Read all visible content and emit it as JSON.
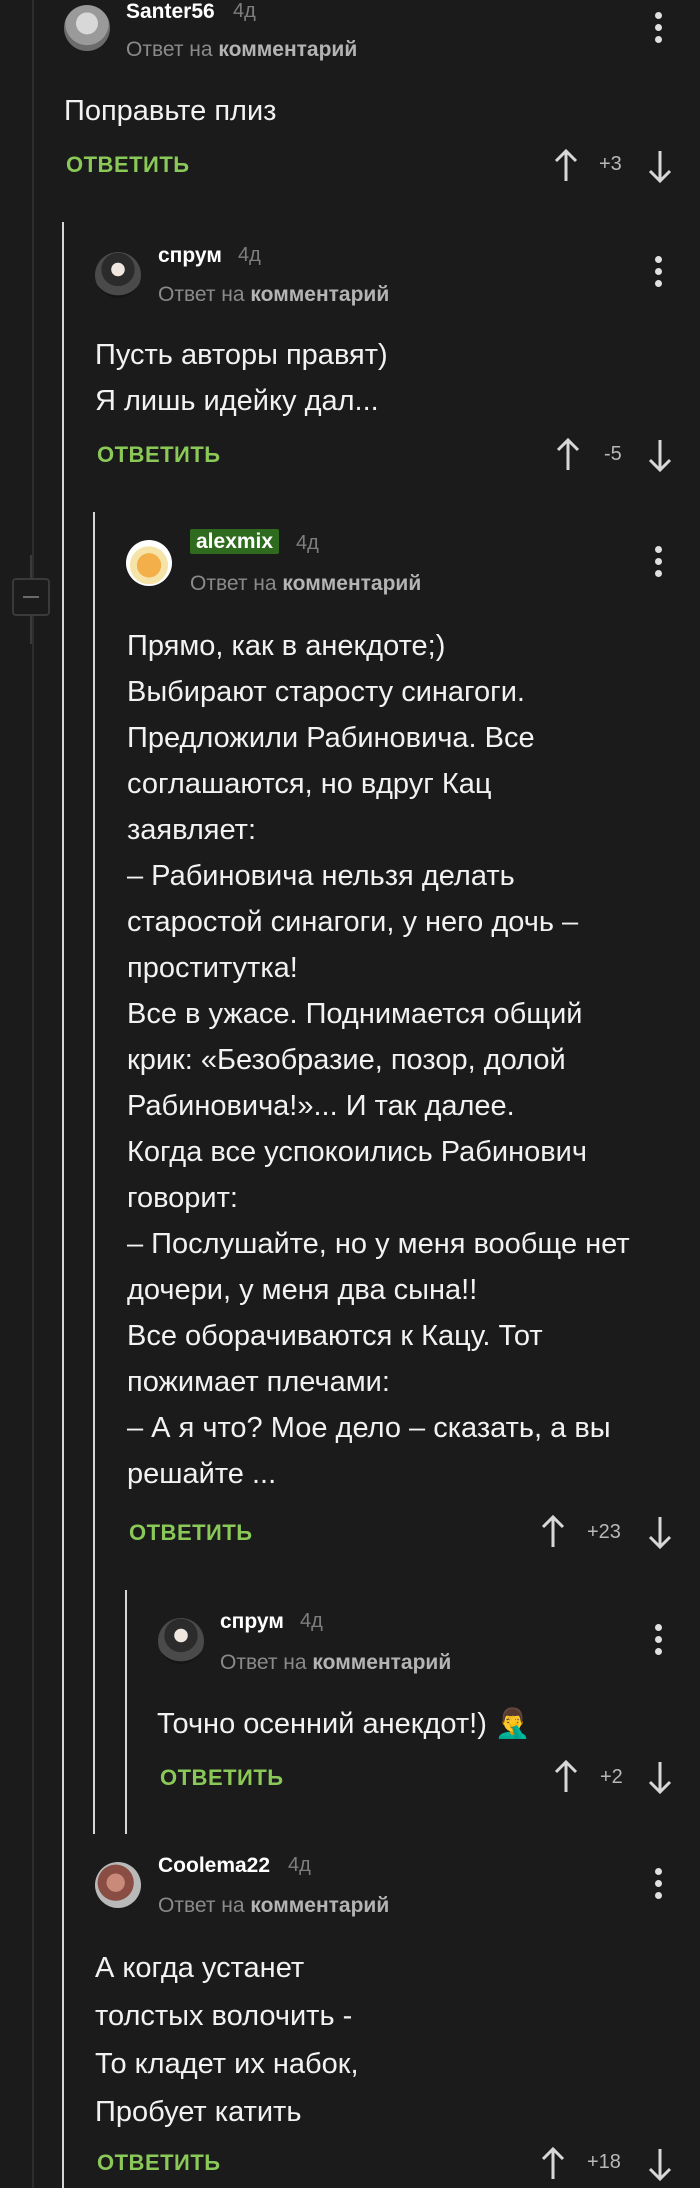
{
  "comments": [
    {
      "id": "c1",
      "author": "Santer56",
      "time": "4д",
      "reply_prefix": "Ответ на ",
      "reply_link": "комментарий",
      "text": "Поправьте плиз",
      "reply_label": "ОТВЕТИТЬ",
      "rating": "+3"
    },
    {
      "id": "c2",
      "author": "спрум",
      "time": "4д",
      "reply_prefix": "Ответ на ",
      "reply_link": "комментарий",
      "text": "Пусть авторы правят)\nЯ лишь идейку дал...",
      "reply_label": "ОТВЕТИТЬ",
      "rating": "-5"
    },
    {
      "id": "c3",
      "author": "alexmix",
      "time": "4д",
      "reply_prefix": "Ответ на ",
      "reply_link": "комментарий",
      "text": "Прямо, как в анекдоте;)\nВыбирают старосту синагоги.\nПредложили Рабиновича. Все\nсоглашаются, но вдруг Кац\nзаявляет:\n– Рабиновича нельзя делать\nстаростой синагоги, у него дочь –\nпроститутка!\nВсе в ужасе. Поднимается общий\nкрик: «Безобразие, позор, долой\nРабиновича!»... И так далее.\nКогда все успокоились Рабинович\nговорит:\n– Послушайте, но у меня вообще нет\nдочери, у меня два сына!!\nВсе оборачиваются к Кацу. Тот\nпожимает плечами:\n– А я что? Мое дело – сказать, а вы\nрешайте ...",
      "reply_label": "ОТВЕТИТЬ",
      "rating": "+23"
    },
    {
      "id": "c4",
      "author": "спрум",
      "time": "4д",
      "reply_prefix": "Ответ на ",
      "reply_link": "комментарий",
      "text": "Точно осенний анекдот!) 🤦‍♂️",
      "reply_label": "ОТВЕТИТЬ",
      "rating": "+2"
    },
    {
      "id": "c5",
      "author": "Coolema22",
      "time": "4д",
      "reply_prefix": "Ответ на ",
      "reply_link": "комментарий",
      "text": "А когда устанет\nтолстых волочить -\nТо кладет их набок,\nПробует катить",
      "reply_label": "ОТВЕТИТЬ",
      "rating": "+18"
    }
  ],
  "colors": {
    "background": "#1b1b1b",
    "reply_button": "#8ac858",
    "username_badge": "#2e6b1f",
    "thread_line": "#d6d6d6"
  },
  "icons": [
    "avatar",
    "kebab-menu-icon",
    "upvote-arrow-icon",
    "downvote-arrow-icon",
    "collapse-thread-icon"
  ]
}
